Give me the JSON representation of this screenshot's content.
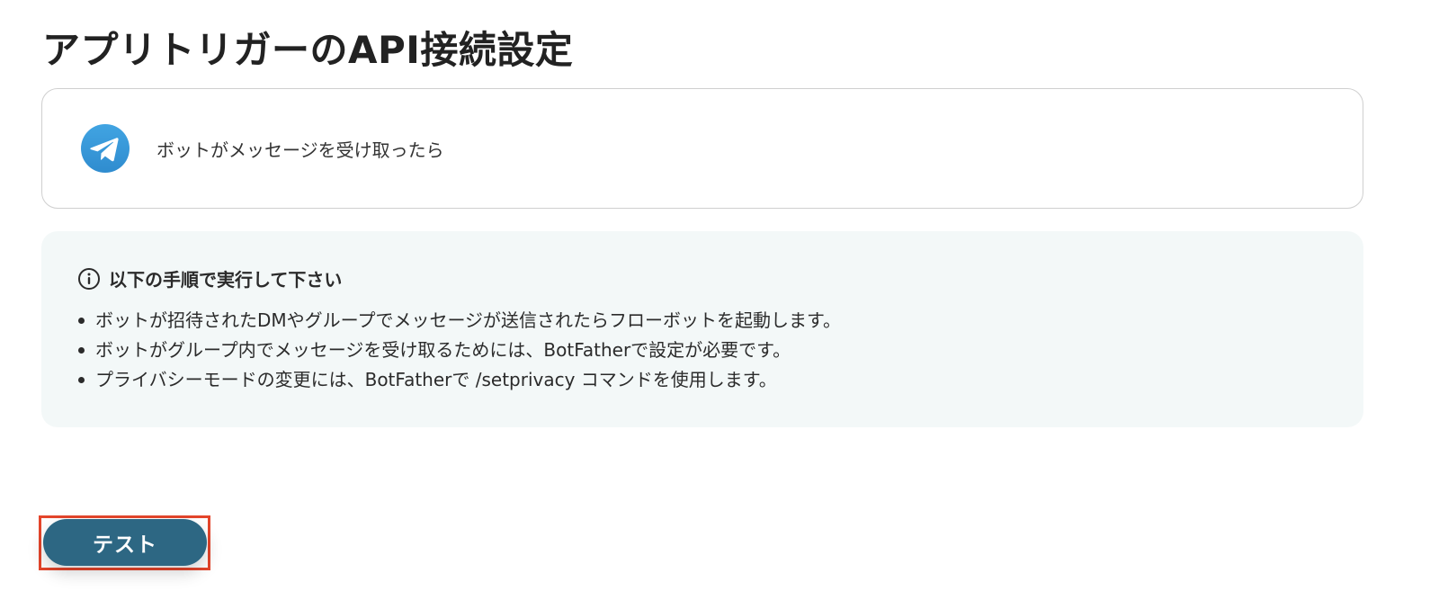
{
  "page": {
    "title": "アプリトリガーのAPI接続設定"
  },
  "trigger": {
    "icon": "telegram-icon",
    "label": "ボットがメッセージを受け取ったら"
  },
  "info": {
    "icon": "info-icon",
    "title": "以下の手順で実行して下さい",
    "items": [
      "ボットが招待されたDMやグループでメッセージが送信されたらフローボットを起動します。",
      "ボットがグループ内でメッセージを受け取るためには、BotFatherで設定が必要です。",
      "プライバシーモードの変更には、BotFatherで /setprivacy コマンドを使用します。"
    ]
  },
  "actions": {
    "test_label": "テスト"
  },
  "colors": {
    "button": "#2d6783",
    "info_background": "#f3f8f8",
    "highlight": "#e4452b",
    "telegram": "#3a9ad9"
  }
}
